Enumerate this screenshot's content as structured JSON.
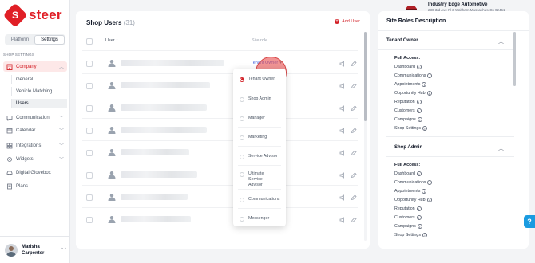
{
  "brand": {
    "name": "steer",
    "letter": "S"
  },
  "sidebar": {
    "toggle": {
      "platform": "Platform",
      "settings": "Settings"
    },
    "section_label": "SHOP SETTINGS",
    "items": [
      {
        "label": "Company",
        "icon": "building-icon"
      },
      {
        "label": "Communication",
        "icon": "chat-icon"
      },
      {
        "label": "Calendar",
        "icon": "calendar-icon"
      },
      {
        "label": "Integrations",
        "icon": "integrations-icon"
      },
      {
        "label": "Widgets",
        "icon": "gear-icon"
      },
      {
        "label": "Digital Glovebox",
        "icon": "car-icon"
      },
      {
        "label": "Plans",
        "icon": "plans-icon"
      }
    ],
    "sub_items": [
      "General",
      "Vehicle Matching",
      "Users"
    ],
    "user": {
      "first": "Marisha",
      "last": "Carpenter"
    }
  },
  "topbar": {
    "company_name": "Industry Edge Automotive",
    "company_address": "230 3rd Ave Fl 3 Waltham Massachusetts 02451"
  },
  "users_card": {
    "title": "Shop Users",
    "count": "(31)",
    "add_label": "Add User",
    "col_user": "User",
    "col_role": "Site role",
    "first_row_role": "Tenant Owner"
  },
  "role_dropdown": {
    "options": [
      "Tenant Owner",
      "Shop Admin",
      "Manager",
      "Marketing",
      "Service Advisor",
      "Ultimate Service Advisor",
      "Communications",
      "Messenger"
    ],
    "selected": "Tenant Owner"
  },
  "roles_panel": {
    "title": "Site Roles Description",
    "sections": [
      {
        "name": "Tenant Owner",
        "access_label": "Full Access:",
        "perms": [
          "Dashboard",
          "Communications",
          "Appointments",
          "Opportunity Hub",
          "Reputation",
          "Customers",
          "Campaigns",
          "Shop Settings"
        ]
      },
      {
        "name": "Shop Admin",
        "access_label": "Full Access:",
        "perms": [
          "Dashboard",
          "Communications",
          "Appointments",
          "Opportunity Hub",
          "Reputation",
          "Customers",
          "Campaigns",
          "Shop Settings"
        ]
      }
    ]
  },
  "help": {
    "label": "?"
  },
  "colors": {
    "brand_red": "#e01f26",
    "link_blue": "#3b5bdb",
    "help_blue": "#1a9be0"
  }
}
